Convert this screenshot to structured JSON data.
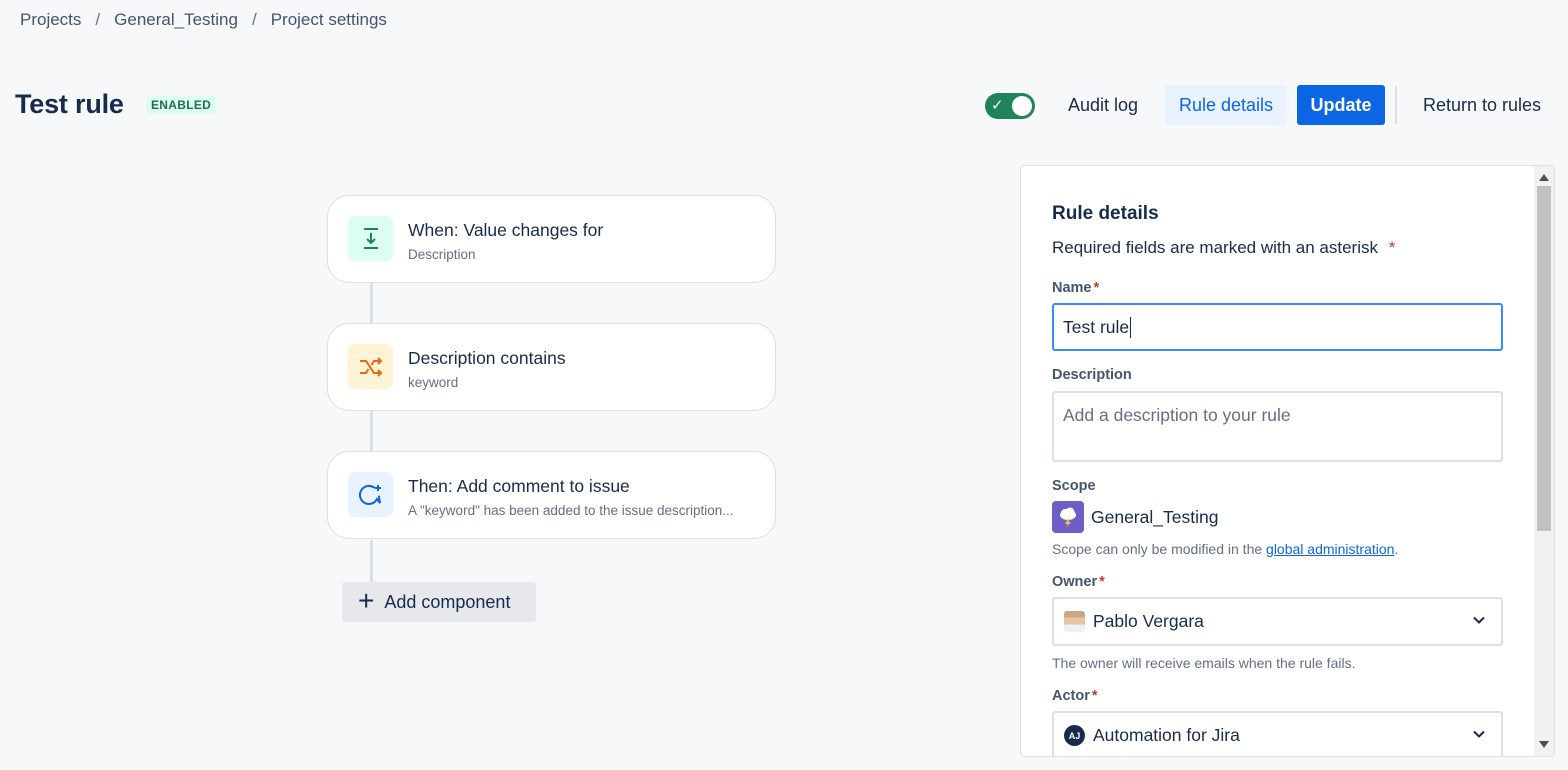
{
  "breadcrumb": [
    "Projects",
    "General_Testing",
    "Project settings"
  ],
  "breadcrumb_separator": "/",
  "header": {
    "title": "Test rule",
    "status": "ENABLED",
    "toggle_state": "on",
    "audit_log": "Audit log",
    "rule_details": "Rule details",
    "update": "Update",
    "return_to_rules": "Return to rules"
  },
  "flow": {
    "components": [
      {
        "title": "When: Value changes for",
        "subtitle": "Description",
        "icon": "trigger-icon",
        "color": "#1f845a"
      },
      {
        "title": "Description contains",
        "subtitle": "keyword",
        "icon": "condition-icon",
        "color": "#e56910"
      },
      {
        "title": "Then: Add comment to issue",
        "subtitle": "A \"keyword\" has been added to the issue description...",
        "icon": "comment-action-icon",
        "color": "#0c66e4"
      }
    ],
    "add_component": "Add component"
  },
  "panel": {
    "title": "Rule details",
    "required_note": "Required fields are marked with an asterisk",
    "asterisk": "*",
    "name_label": "Name",
    "name_value": "Test rule",
    "description_label": "Description",
    "description_placeholder": "Add a description to your rule",
    "scope_label": "Scope",
    "scope_value": "General_Testing",
    "scope_help_prefix": "Scope can only be modified in the ",
    "scope_help_link": "global administration",
    "scope_help_suffix": ".",
    "owner_label": "Owner",
    "owner_value": "Pablo Vergara",
    "owner_help": "The owner will receive emails when the rule fails.",
    "actor_label": "Actor",
    "actor_value": "Automation for Jira",
    "actor_initials": "AJ"
  },
  "colors": {
    "primary": "#0c66e4",
    "toggle_on": "#1f845a",
    "enabled_badge_bg": "#dcfff1",
    "required": "#c9372c"
  }
}
